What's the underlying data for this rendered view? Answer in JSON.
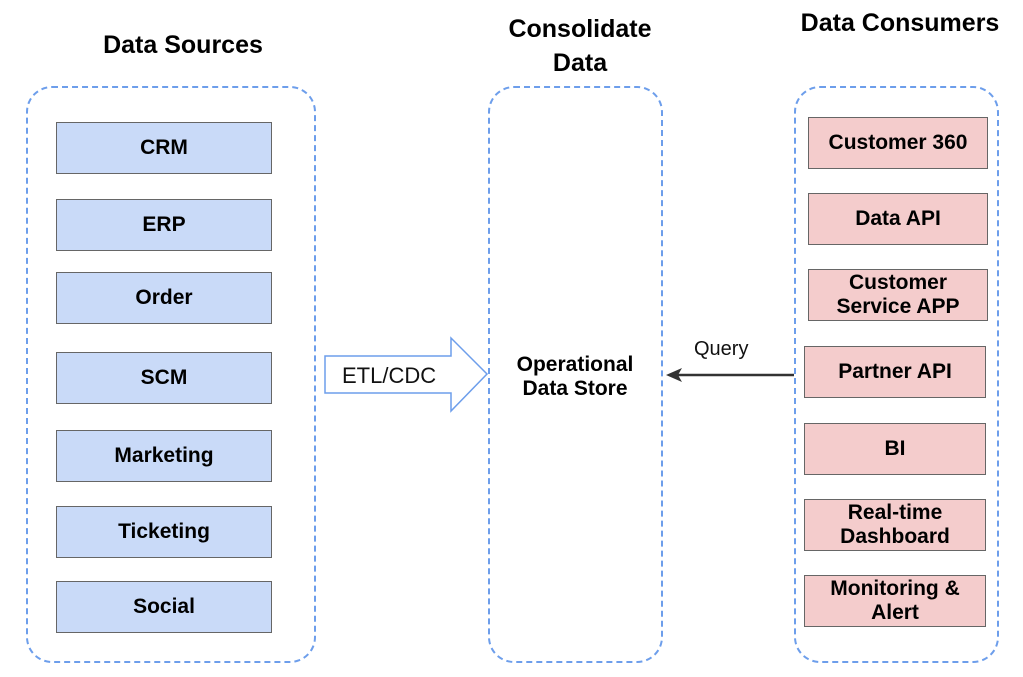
{
  "titles": {
    "sources": "Data Sources",
    "consolidate": "Consolidate Data",
    "consumers": "Data Consumers"
  },
  "sources": [
    "CRM",
    "ERP",
    "Order",
    "SCM",
    "Marketing",
    "Ticketing",
    "Social"
  ],
  "store": "Operational Data Store",
  "consumers": [
    "Customer 360",
    "Data API",
    "Customer Service APP",
    "Partner API",
    "BI",
    "Real-time Dashboard",
    "Monitoring & Alert"
  ],
  "etl_label": "ETL/CDC",
  "query_label": "Query",
  "colors": {
    "source_fill": "#c9daf8",
    "consumer_fill": "#f4cccc",
    "dashed_border": "#6d9eeb",
    "arrow_outline": "#6d9eeb"
  }
}
